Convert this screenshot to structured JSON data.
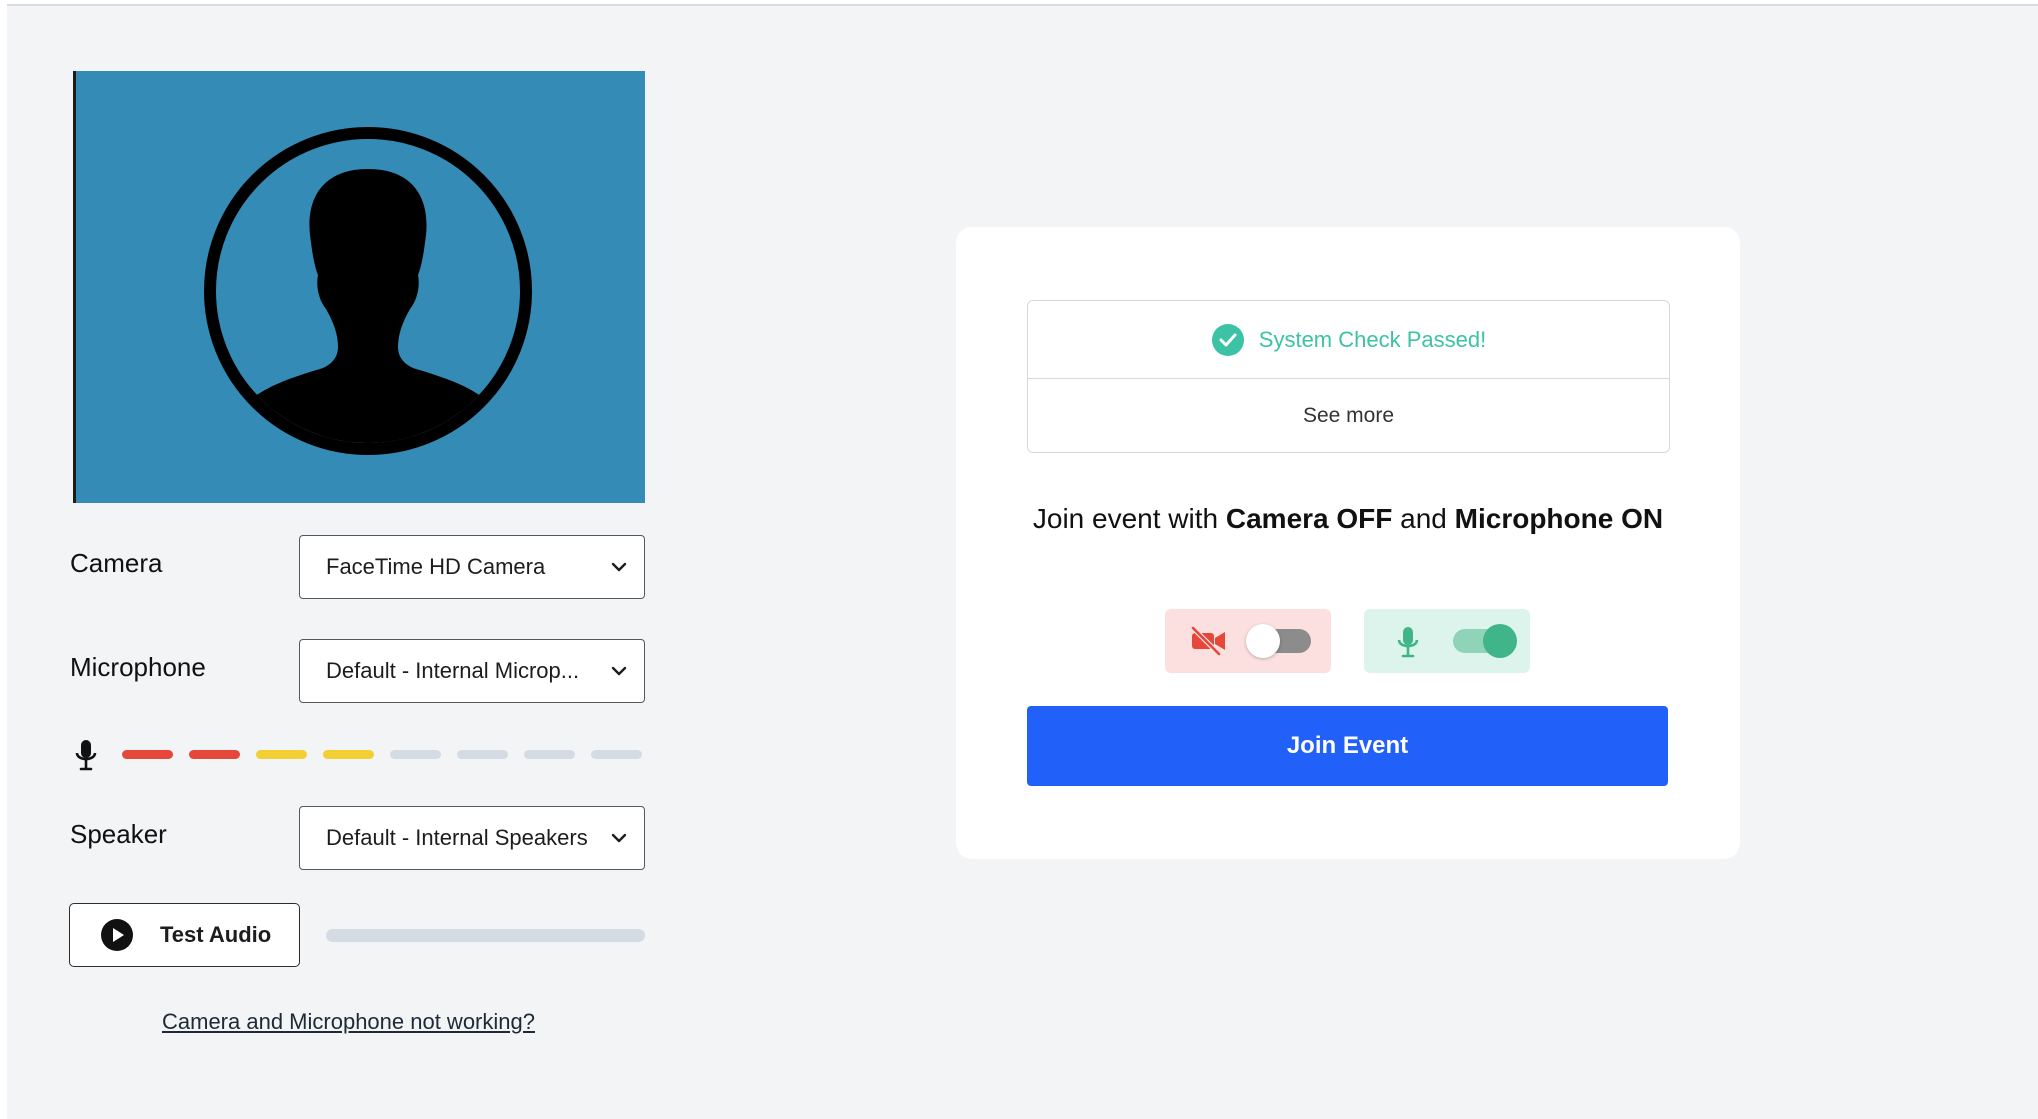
{
  "devices": {
    "camera": {
      "label": "Camera",
      "value": "FaceTime HD Camera"
    },
    "microphone": {
      "label": "Microphone",
      "value": "Default - Internal Microp..."
    },
    "speaker": {
      "label": "Speaker",
      "value": "Default - Internal Speakers"
    }
  },
  "mic_level": {
    "segments": [
      "#e5483b",
      "#e5483b",
      "#f2cf34",
      "#f2cf34",
      "#d4dbe3",
      "#d4dbe3",
      "#d4dbe3",
      "#d4dbe3"
    ],
    "active_segments": 4,
    "total_segments": 8
  },
  "test_audio": {
    "label": "Test Audio",
    "progress": 0
  },
  "trouble_link": "Camera and Microphone not working?",
  "system_check": {
    "status": "System Check Passed!",
    "see_more": "See more",
    "status_color": "#3cc2a5"
  },
  "join_prompt": {
    "prefix": "Join event with ",
    "camera_state": "Camera OFF",
    "middle": " and ",
    "mic_state": "Microphone ON"
  },
  "toggles": {
    "camera": {
      "on": false,
      "icon": "video-off-icon",
      "color": "#e5483b"
    },
    "microphone": {
      "on": true,
      "icon": "microphone-icon",
      "color": "#3fb589"
    }
  },
  "join_button": "Join Event",
  "colors": {
    "primary": "#2260fa",
    "preview_bg": "#348bb6",
    "page_bg": "#f3f4f6"
  }
}
